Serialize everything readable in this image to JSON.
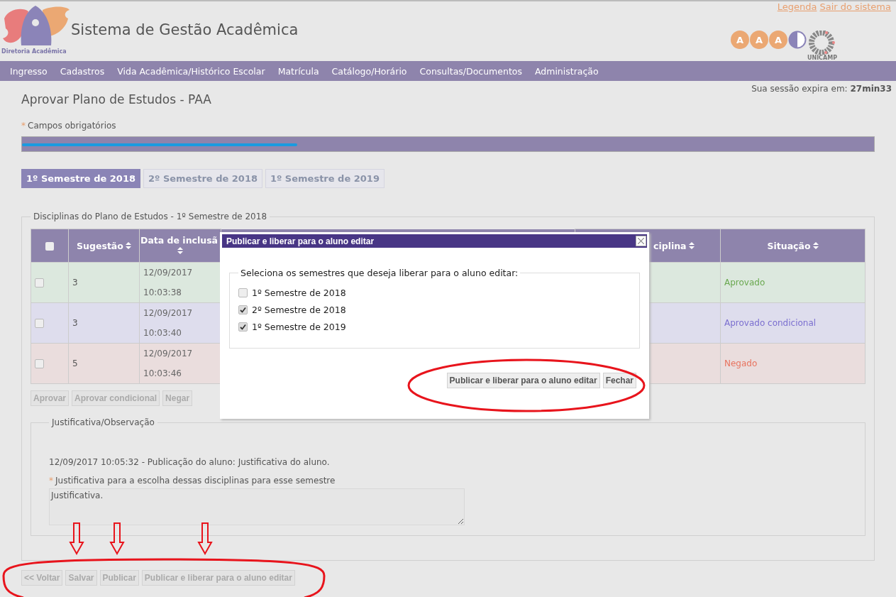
{
  "header": {
    "logo_caption": "Diretoria Acadêmica",
    "title": "Sistema de Gestão Acadêmica",
    "links": [
      "Legenda",
      "Sair do sistema"
    ],
    "partner_logo": {
      "letters": [
        "A",
        "A",
        "A"
      ],
      "caption": "UNICAMP"
    }
  },
  "nav": [
    "Ingresso",
    "Cadastros",
    "Vida Acadêmica/Histórico Escolar",
    "Matrícula",
    "Catálogo/Horário",
    "Consultas/Documentos",
    "Administração"
  ],
  "session": {
    "label": "Sua sessão expira em:",
    "time": "27min33"
  },
  "page_title": "Aprovar Plano de Estudos - PAA",
  "required_note": {
    "mark": "*",
    "text": "Campos obrigatórios"
  },
  "tabs": [
    {
      "label": "1º Semestre de 2018",
      "selected": true
    },
    {
      "label": "2º Semestre de 2018",
      "selected": false
    },
    {
      "label": "1º Semestre de 2019",
      "selected": false
    }
  ],
  "plan": {
    "legend": "Disciplinas do Plano de Estudos - 1º Semestre de 2018",
    "columns": [
      {
        "kind": "checkbox",
        "checked": false
      },
      {
        "kind": "text",
        "label": "Sugestão"
      },
      {
        "kind": "text",
        "label": "Data de inclusã"
      },
      {
        "kind": "hidden"
      },
      {
        "kind": "hidden"
      },
      {
        "kind": "text",
        "label": "ciplina"
      },
      {
        "kind": "text",
        "label": "Situação"
      }
    ],
    "rows": [
      {
        "kind": "approved",
        "checked": false,
        "suggestion": "3",
        "date": "12/09/2017",
        "time": "10:03:38",
        "situation": "Aprovado",
        "color": "#6aa84f"
      },
      {
        "kind": "conditional",
        "checked": false,
        "suggestion": "3",
        "date": "12/09/2017",
        "time": "10:03:40",
        "situation": "Aprovado condicional",
        "color": "#7b6fd0"
      },
      {
        "kind": "denied",
        "checked": false,
        "suggestion": "5",
        "date": "12/09/2017",
        "time": "10:03:46",
        "situation": "Negado",
        "color": "#e8735f"
      }
    ],
    "buttons": [
      {
        "label": "Aprovar",
        "disabled": true
      },
      {
        "label": "Aprovar condicional",
        "disabled": true
      },
      {
        "label": "Negar",
        "disabled": true
      }
    ]
  },
  "justification": {
    "legend": "Justificativa/Observação",
    "history": "12/09/2017 10:05:32 - Publicação do aluno: Justificativa do aluno.",
    "field_mark": "*",
    "field_label": "Justificativa para a escolha dessas disciplinas para esse semestre",
    "value": "Justificativa."
  },
  "bottom_buttons": [
    {
      "label": "<< Voltar",
      "disabled": true
    },
    {
      "label": "Salvar",
      "disabled": true
    },
    {
      "label": "Publicar",
      "disabled": true
    },
    {
      "label": "Publicar e liberar para o aluno editar",
      "disabled": true
    }
  ],
  "dialog": {
    "title": "Publicar e liberar para o aluno editar",
    "legend": "Seleciona os semestres que deseja liberar para o aluno editar:",
    "options": [
      {
        "label": "1º Semestre de 2018",
        "checked": false
      },
      {
        "label": "2º Semestre de 2018",
        "checked": true
      },
      {
        "label": "1º Semestre de 2019",
        "checked": true
      }
    ],
    "buttons": [
      "Publicar e liberar para o aluno editar",
      "Fechar"
    ]
  }
}
